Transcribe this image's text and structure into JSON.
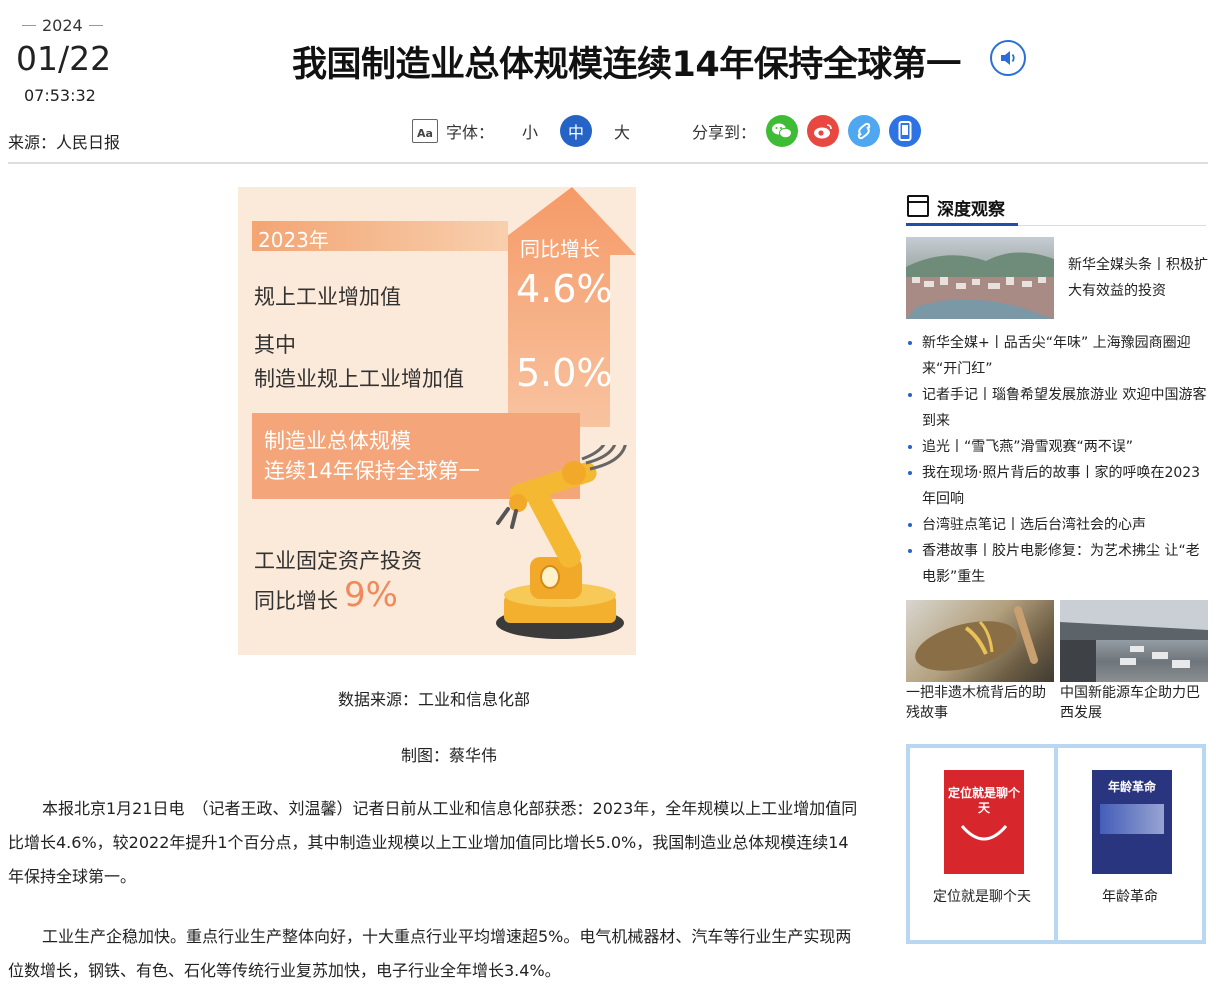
{
  "header": {
    "year": "2024",
    "month_day": "01/22",
    "time": "07:53:32",
    "source": "来源：人民日报",
    "title": "我国制造业总体规模连续14年保持全球第一"
  },
  "toolbar": {
    "font_icon_text": "Aa",
    "font_label": "字体：",
    "sizes": [
      "小",
      "中",
      "大"
    ],
    "share_label": "分享到："
  },
  "colors": {
    "accent": "#2563c7",
    "wechat": "#3fbc35",
    "weibo": "#e8483f",
    "link_share": "#4ea7ef",
    "mobile_share": "#2d73e3",
    "infographic_bg": "#fbe9d9",
    "infographic_orange": "#f4a67a"
  },
  "infographic": {
    "year": "2023年",
    "yoy_label": "同比增长",
    "line1": "规上工业增加值",
    "value1": "4.6%",
    "line2": "其中",
    "line3": "制造业规上工业增加值",
    "value2": "5.0%",
    "band_line1": "制造业总体规模",
    "band_line2": "连续14年保持全球第一",
    "line4": "工业固定资产投资",
    "line5": "同比增长",
    "value3": "9%"
  },
  "captions": {
    "data_source": "数据来源：工业和信息化部",
    "chart_by": "制图：蔡华伟"
  },
  "article": {
    "p1": "本报北京1月21日电　（记者王政、刘温馨）记者日前从工业和信息化部获悉：2023年，全年规模以上工业增加值同比增长4.6%，较2022年提升1个百分点，其中制造业规模以上工业增加值同比增长5.0%，我国制造业总体规模连续14年保持全球第一。",
    "p2": "工业生产企稳加快。重点行业生产整体向好，十大重点行业平均增速超5%。电气机械器材、汽车等行业生产实现两位数增长，钢铁、有色、石化等传统行业复苏加快，电子行业全年增长3.4%。"
  },
  "sidebar": {
    "heading": "深度观察",
    "featured": "新华全媒头条丨积极扩大有效益的投资",
    "news": [
      "新华全媒+丨品舌尖“年味” 上海豫园商圈迎来“开门红”",
      "记者手记丨瑙鲁希望发展旅游业 欢迎中国游客到来",
      "追光丨“雪飞燕”滑雪观赛“两不误”",
      "我在现场·照片背后的故事丨家的呼唤在2023年回响",
      "台湾驻点笔记丨选后台湾社会的心声",
      "香港故事丨胶片电影修复：为艺术拂尘 让“老电影”重生"
    ],
    "pictures": [
      "一把非遗木梳背后的助残故事",
      "中国新能源车企助力巴西发展"
    ],
    "books": [
      {
        "title": "定位就是聊个天",
        "cover_text": "定位就是聊个天"
      },
      {
        "title": "年龄革命",
        "cover_text": "年龄革命"
      }
    ]
  }
}
